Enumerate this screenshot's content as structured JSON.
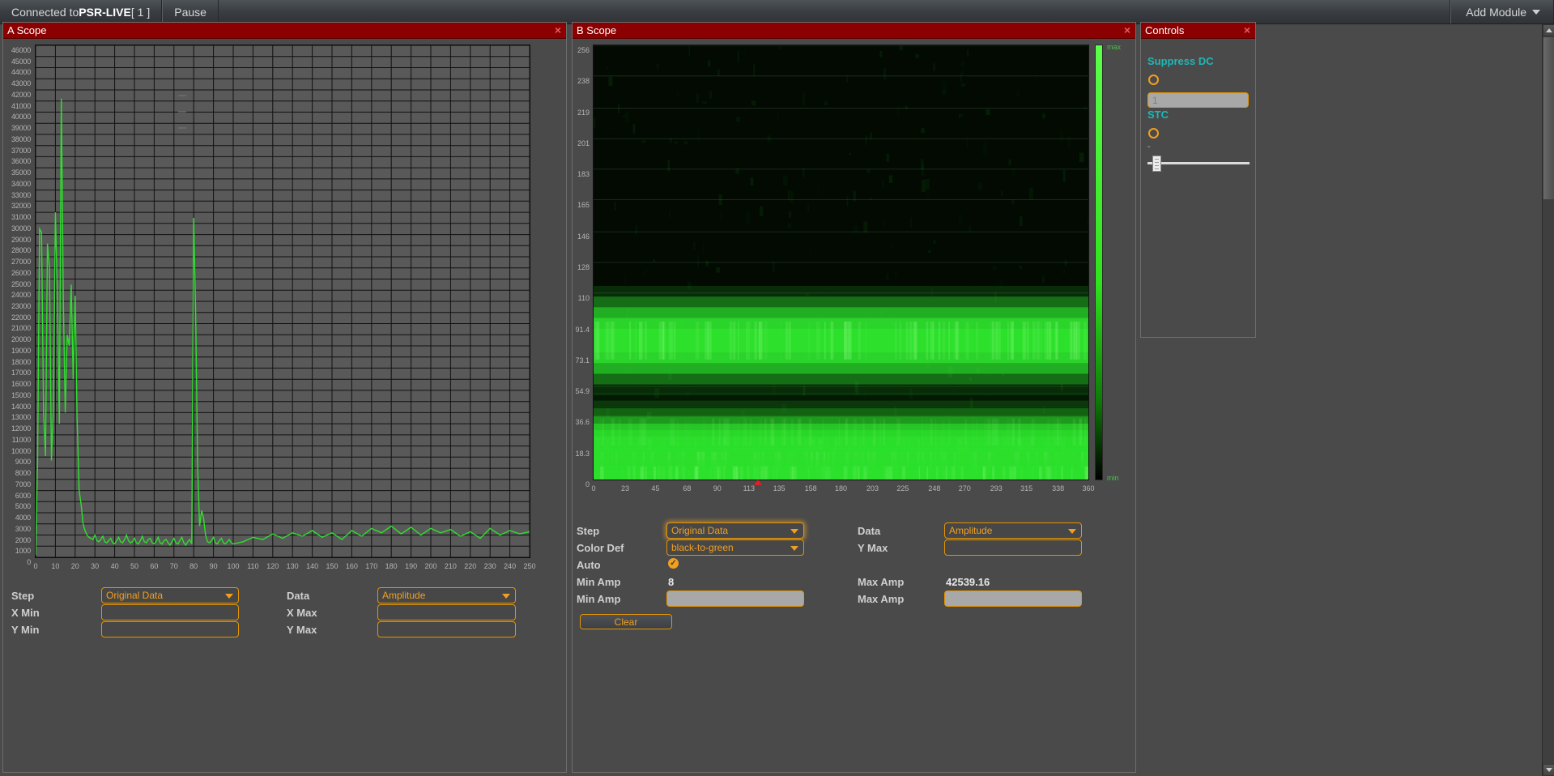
{
  "topbar": {
    "connection_prefix": "Connected to ",
    "connection_name": "PSR-LIVE",
    "connection_suffix": " [ 1 ]",
    "pause_label": "Pause",
    "add_module_label": "Add Module",
    "caret_icon": "chevron-down-icon"
  },
  "panels": {
    "a_scope_title": "A Scope",
    "b_scope_title": "B Scope",
    "controls_title": "Controls",
    "close_glyph": "×"
  },
  "a_scope": {
    "y_ticks": [
      "46000",
      "45000",
      "44000",
      "43000",
      "42000",
      "41000",
      "40000",
      "39000",
      "38000",
      "37000",
      "36000",
      "35000",
      "34000",
      "33000",
      "32000",
      "31000",
      "30000",
      "29000",
      "28000",
      "27000",
      "26000",
      "25000",
      "24000",
      "23000",
      "22000",
      "21000",
      "20000",
      "19000",
      "18000",
      "17000",
      "16000",
      "15000",
      "14000",
      "13000",
      "12000",
      "11000",
      "10000",
      "9000",
      "8000",
      "7000",
      "6000",
      "5000",
      "4000",
      "3000",
      "2000",
      "1000",
      "0"
    ],
    "x_ticks": [
      "0",
      "10",
      "20",
      "30",
      "40",
      "50",
      "60",
      "70",
      "80",
      "90",
      "100",
      "110",
      "120",
      "130",
      "140",
      "150",
      "160",
      "170",
      "180",
      "190",
      "200",
      "210",
      "220",
      "230",
      "240",
      "250"
    ],
    "trace_color": "#2de02d",
    "form": {
      "step_label": "Step",
      "step_value": "Original Data",
      "data_label": "Data",
      "data_value": "Amplitude",
      "xmin_label": "X Min",
      "xmin_value": "",
      "xmax_label": "X Max",
      "xmax_value": "",
      "ymin_label": "Y Min",
      "ymin_value": "",
      "ymax_label": "Y Max",
      "ymax_value": ""
    }
  },
  "b_scope": {
    "y_ticks": [
      "256",
      "238",
      "219",
      "201",
      "183",
      "165",
      "146",
      "128",
      "110",
      "91.4",
      "73.1",
      "54.9",
      "36.6",
      "18.3",
      "0"
    ],
    "x_ticks": [
      "0",
      "23",
      "45",
      "68",
      "90",
      "113",
      "135",
      "158",
      "180",
      "203",
      "225",
      "248",
      "270",
      "293",
      "315",
      "338",
      "360"
    ],
    "marker_value": "120",
    "colorbar": {
      "max_label": "max",
      "min_label": "min",
      "def": "black-to-green"
    },
    "form": {
      "step_label": "Step",
      "step_value": "Original Data",
      "data_label": "Data",
      "data_value": "Amplitude",
      "colordef_label": "Color Def",
      "colordef_value": "black-to-green",
      "ymax_label": "Y Max",
      "ymax_value": "",
      "auto_label": "Auto",
      "auto_checked": true,
      "minamp_label": "Min Amp",
      "minamp_value": "8",
      "maxamp_label": "Max Amp",
      "maxamp_value": "42539.16",
      "minamp_input_label": "Min Amp",
      "minamp_input_value": "",
      "maxamp_input_label": "Max Amp",
      "maxamp_input_value": "",
      "clear_label": "Clear"
    }
  },
  "controls": {
    "suppress_dc_label": "Suppress DC",
    "suppress_dc_value": "1",
    "stc_label": "STC",
    "stc_dash": "-"
  },
  "chart_data": {
    "type": "line",
    "title": "A Scope",
    "xlabel": "",
    "ylabel": "",
    "xlim": [
      0,
      250
    ],
    "ylim": [
      0,
      46000
    ],
    "grid": true,
    "legend": "none",
    "series": [
      {
        "name": "Amplitude",
        "color": "#2de02d",
        "x": [
          0,
          1,
          2,
          3,
          4,
          5,
          6,
          7,
          8,
          9,
          10,
          11,
          12,
          13,
          14,
          15,
          16,
          17,
          18,
          19,
          20,
          21,
          22,
          23,
          24,
          25,
          26,
          27,
          28,
          29,
          30,
          31,
          32,
          33,
          34,
          35,
          36,
          37,
          38,
          39,
          40,
          41,
          42,
          43,
          44,
          45,
          46,
          47,
          48,
          49,
          50,
          51,
          52,
          53,
          54,
          55,
          56,
          57,
          58,
          59,
          60,
          61,
          62,
          63,
          64,
          65,
          66,
          67,
          68,
          69,
          70,
          71,
          72,
          73,
          74,
          75,
          76,
          77,
          78,
          79,
          80,
          81,
          82,
          83,
          84,
          85,
          86,
          87,
          88,
          89,
          90,
          91,
          92,
          93,
          94,
          95,
          96,
          97,
          98,
          99,
          100,
          105,
          110,
          115,
          120,
          125,
          130,
          135,
          140,
          145,
          150,
          155,
          160,
          165,
          170,
          175,
          180,
          185,
          190,
          195,
          200,
          205,
          210,
          215,
          220,
          225,
          230,
          235,
          240,
          245,
          250
        ],
        "y": [
          200,
          8600,
          29500,
          29200,
          13000,
          9100,
          28200,
          26000,
          8700,
          13500,
          31000,
          24000,
          12000,
          41200,
          23000,
          13000,
          20000,
          19000,
          24500,
          16000,
          23500,
          12500,
          6000,
          4800,
          3000,
          2400,
          2000,
          1800,
          1700,
          1600,
          2000,
          1500,
          1400,
          1600,
          1900,
          1400,
          1300,
          1500,
          1700,
          1300,
          1200,
          1500,
          1800,
          1400,
          1300,
          1600,
          2000,
          1500,
          1300,
          1400,
          1700,
          1300,
          1200,
          1500,
          1900,
          1400,
          1300,
          1600,
          1700,
          1300,
          1200,
          1400,
          1800,
          1300,
          1200,
          1500,
          1600,
          1300,
          1100,
          1400,
          1700,
          1300,
          1200,
          1500,
          1800,
          1300,
          1100,
          1400,
          1600,
          1200,
          30500,
          22000,
          8000,
          2800,
          4200,
          3500,
          2000,
          1400,
          1300,
          1500,
          1800,
          1300,
          1200,
          1500,
          1700,
          1300,
          1200,
          1400,
          1600,
          1300,
          1200,
          1400,
          1800,
          1600,
          2100,
          1700,
          2200,
          1900,
          2400,
          1800,
          2200,
          1600,
          2400,
          1900,
          2600,
          2200,
          2800,
          2100,
          2700,
          2000,
          2600,
          2200,
          2500,
          1900,
          2300,
          1700,
          2600,
          2000,
          2400,
          2100,
          2300
        ]
      }
    ]
  },
  "chart_data_b": {
    "type": "heatmap",
    "title": "B Scope",
    "xlabel": "",
    "ylabel": "",
    "xlim": [
      0,
      360
    ],
    "ylim": [
      0,
      256
    ],
    "colormap": "black-to-green",
    "min_amp": 8,
    "max_amp": 42539.16,
    "bands": [
      {
        "y_center": 82,
        "y_halfwidth": 7,
        "intensity": 1.0
      },
      {
        "y_center": 18,
        "y_halfwidth": 4,
        "intensity": 1.0
      },
      {
        "y_center": 10,
        "y_halfwidth": 4,
        "intensity": 1.0
      },
      {
        "y_center": 3,
        "y_halfwidth": 3,
        "intensity": 0.95
      },
      {
        "y_center": 28,
        "y_halfwidth": 5,
        "intensity": 0.45
      }
    ]
  }
}
